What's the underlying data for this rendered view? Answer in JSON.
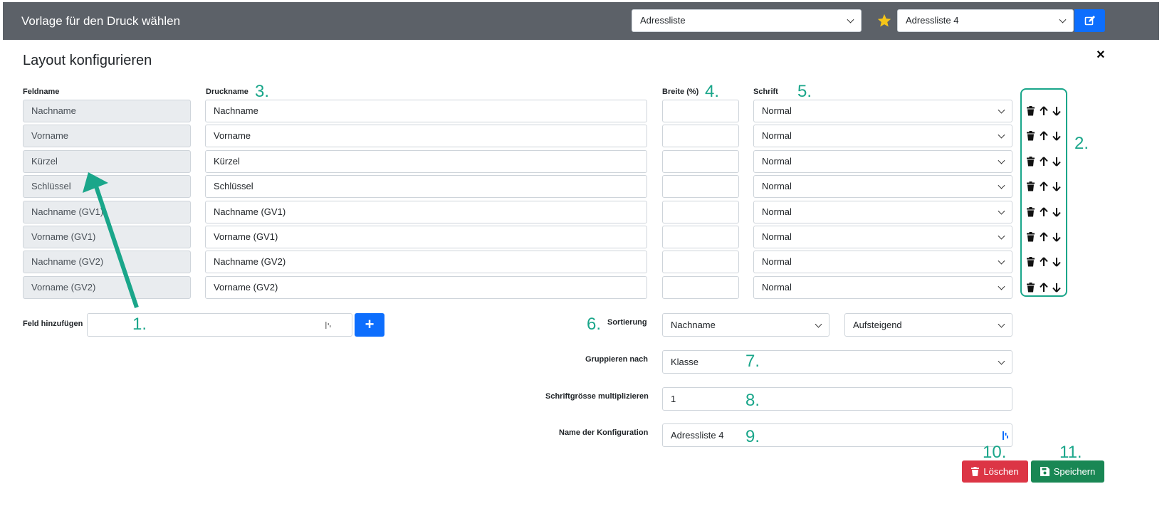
{
  "header": {
    "title": "Vorlage für den Druck wählen",
    "template_select": "Adressliste",
    "config_select": "Adressliste 4",
    "star_color": "#f5c518",
    "edit_icon": "edit-icon"
  },
  "panel": {
    "title": "Layout konfigurieren",
    "close_label": "×"
  },
  "columns": {
    "feldname": "Feldname",
    "druckname": "Druckname",
    "breite": "Breite (%)",
    "schrift": "Schrift"
  },
  "rows": [
    {
      "feld": "Nachname",
      "druck": "Nachname",
      "breite": "",
      "schrift": "Normal"
    },
    {
      "feld": "Vorname",
      "druck": "Vorname",
      "breite": "",
      "schrift": "Normal"
    },
    {
      "feld": "Kürzel",
      "druck": "Kürzel",
      "breite": "",
      "schrift": "Normal"
    },
    {
      "feld": "Schlüssel",
      "druck": "Schlüssel",
      "breite": "",
      "schrift": "Normal"
    },
    {
      "feld": "Nachname (GV1)",
      "druck": "Nachname (GV1)",
      "breite": "",
      "schrift": "Normal"
    },
    {
      "feld": "Vorname (GV1)",
      "druck": "Vorname (GV1)",
      "breite": "",
      "schrift": "Normal"
    },
    {
      "feld": "Nachname (GV2)",
      "druck": "Nachname (GV2)",
      "breite": "",
      "schrift": "Normal"
    },
    {
      "feld": "Vorname (GV2)",
      "druck": "Vorname (GV2)",
      "breite": "",
      "schrift": "Normal"
    }
  ],
  "add_field": {
    "label": "Feld hinzufügen",
    "value": "",
    "add_label": "+"
  },
  "sorting": {
    "label": "Sortierung",
    "field": "Nachname",
    "direction": "Aufsteigend"
  },
  "grouping": {
    "label": "Gruppieren nach",
    "value": "Klasse"
  },
  "font_multiplier": {
    "label": "Schriftgrösse multiplizieren",
    "value": "1"
  },
  "config_name": {
    "label": "Name der Konfiguration",
    "value": "Adressliste 4"
  },
  "buttons": {
    "delete": "Löschen",
    "save": "Speichern",
    "delete_color": "#dc3545",
    "save_color": "#198754"
  },
  "annotations": [
    "1.",
    "2.",
    "3.",
    "4.",
    "5.",
    "6.",
    "7.",
    "8.",
    "9.",
    "10.",
    "11."
  ],
  "annotation_color": "#1aa68a"
}
